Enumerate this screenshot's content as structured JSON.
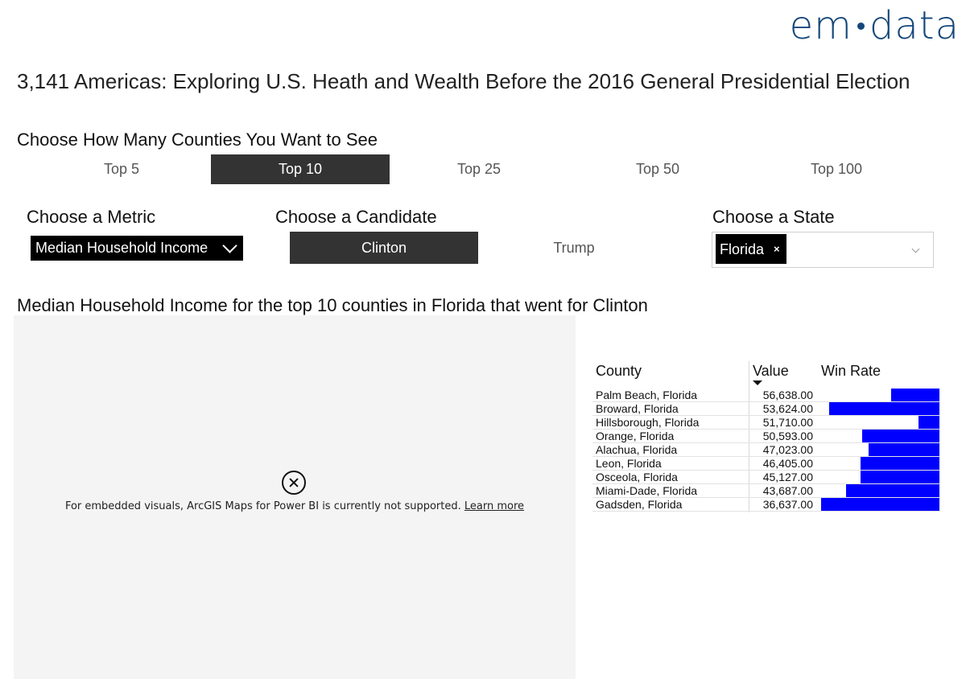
{
  "logo": {
    "part1": "em",
    "part2": "data"
  },
  "page_title": "3,141 Americas: Exploring U.S. Heath and Wealth Before the 2016 General Presidential Election",
  "count_slicer": {
    "label": "Choose How Many Counties You Want to See",
    "options": [
      {
        "label": "Top 5",
        "selected": false
      },
      {
        "label": "Top 10",
        "selected": true
      },
      {
        "label": "Top 25",
        "selected": false
      },
      {
        "label": "Top 50",
        "selected": false
      },
      {
        "label": "Top 100",
        "selected": false
      }
    ]
  },
  "metric": {
    "label": "Choose a Metric",
    "selected": "Median Household Income"
  },
  "candidate": {
    "label": "Choose a Candidate",
    "options": [
      {
        "label": "Clinton",
        "selected": true
      },
      {
        "label": "Trump",
        "selected": false
      }
    ]
  },
  "state": {
    "label": "Choose a State",
    "selected_tag": "Florida",
    "remove_glyph": "×"
  },
  "chart_title": "Median Household Income for the top 10 counties in Florida that went for Clinton",
  "map": {
    "message": "For embedded visuals, ArcGIS Maps for Power BI is currently not supported.",
    "link": "Learn more"
  },
  "table": {
    "headers": {
      "county": "County",
      "value": "Value",
      "win_rate": "Win Rate"
    },
    "rows": [
      {
        "county": "Palm Beach, Florida",
        "value": "56,638.00",
        "win_rate": 0.41
      },
      {
        "county": "Broward, Florida",
        "value": "53,624.00",
        "win_rate": 0.93
      },
      {
        "county": "Hillsborough, Florida",
        "value": "51,710.00",
        "win_rate": 0.18
      },
      {
        "county": "Orange, Florida",
        "value": "50,593.00",
        "win_rate": 0.65
      },
      {
        "county": "Alachua, Florida",
        "value": "47,023.00",
        "win_rate": 0.6
      },
      {
        "county": "Leon, Florida",
        "value": "46,405.00",
        "win_rate": 0.67
      },
      {
        "county": "Osceola, Florida",
        "value": "45,127.00",
        "win_rate": 0.67
      },
      {
        "county": "Miami-Dade, Florida",
        "value": "43,687.00",
        "win_rate": 0.79
      },
      {
        "county": "Gadsden, Florida",
        "value": "36,637.00",
        "win_rate": 1.0
      }
    ]
  },
  "colors": {
    "logo": "#15477a",
    "selected_bg": "#333333",
    "bar": "#0000ff",
    "map_bg": "#f4f4f4"
  }
}
